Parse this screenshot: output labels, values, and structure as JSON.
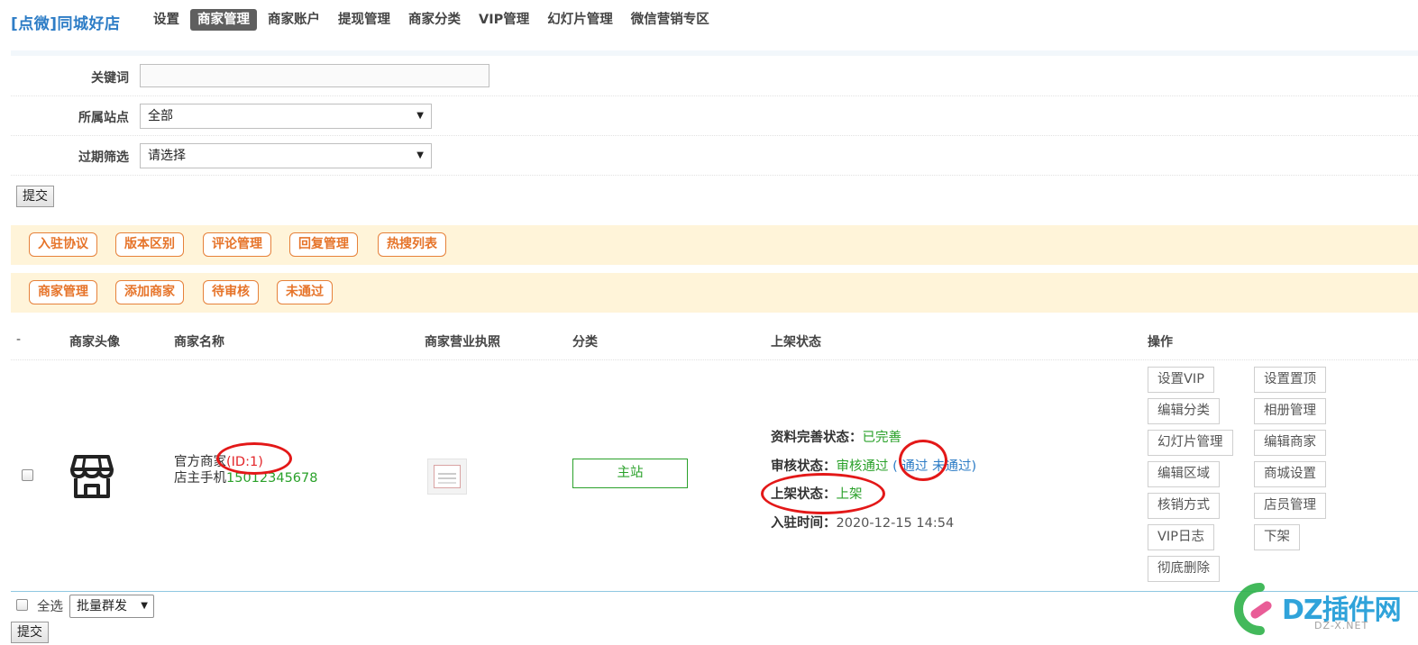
{
  "brand": "[点微]同城好店",
  "nav": [
    "设置",
    "商家管理",
    "商家账户",
    "提现管理",
    "商家分类",
    "VIP管理",
    "幻灯片管理",
    "微信营销专区"
  ],
  "filter": {
    "keyword_label": "关键词",
    "keyword_value": "",
    "site_label": "所属站点",
    "site_value": "全部",
    "expire_label": "过期筛选",
    "expire_value": "请选择",
    "submit": "提交"
  },
  "bar1": [
    "入驻协议",
    "版本区别",
    "评论管理",
    "回复管理",
    "热搜列表"
  ],
  "bar2": [
    "商家管理",
    "添加商家",
    "待审核",
    "未通过"
  ],
  "table": {
    "headers": [
      "-",
      "商家头像",
      "商家名称",
      "商家营业执照",
      "分类",
      "上架状态",
      "操作"
    ],
    "row": {
      "name_prefix": "官方商家",
      "id_text": "(ID:1)",
      "phone_label": "店主手机",
      "phone": "15012345678",
      "category": "主站",
      "info_label": "资料完善状态：",
      "info_value": "已完善",
      "audit_label": "审核状态：",
      "audit_value": "审核通过",
      "audit_open": "(",
      "audit_pass": "通过",
      "audit_fail": "未通过",
      "audit_close": ")",
      "shelf_label": "上架状态：",
      "shelf_value": "上架",
      "time_label": "入驻时间：",
      "time_value": "2020-12-15 14:54",
      "ops": [
        "设置VIP",
        "设置置顶",
        "编辑分类",
        "相册管理",
        "幻灯片管理",
        "编辑商家",
        "编辑区域",
        "商城设置",
        "核销方式",
        "店员管理",
        "VIP日志",
        "下架",
        "彻底删除"
      ]
    }
  },
  "bottom": {
    "select_all": "全选",
    "batch_value": "批量群发",
    "submit": "提交"
  },
  "watermark": {
    "text": "DZ插件网",
    "sub": "DZ-X.NET"
  },
  "colors": {
    "brand": "#2e7dc6",
    "orange": "#e6742a",
    "green": "#2aa12a",
    "red": "#e3262a"
  }
}
